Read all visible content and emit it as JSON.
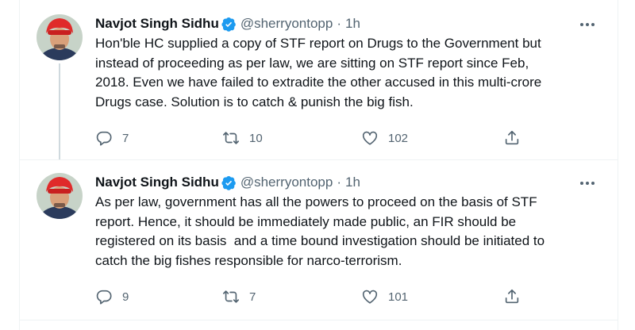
{
  "tweets": [
    {
      "author": "Navjot Singh Sidhu",
      "handle": "@sherryontopp",
      "separator": "·",
      "time": "1h",
      "text": "Hon'ble HC supplied a copy of STF report on Drugs to the Government but\ninstead of proceeding as per law, we are sitting on STF report since Feb,\n2018. Even we have failed to extradite the other accused in this multi-crore\nDrugs case. Solution is to catch & punish the big fish.",
      "replies": "7",
      "retweets": "10",
      "likes": "102"
    },
    {
      "author": "Navjot Singh Sidhu",
      "handle": "@sherryontopp",
      "separator": "·",
      "time": "1h",
      "text": "As per law, government has all the powers to proceed on the basis of STF\nreport. Hence, it should be immediately made public, an FIR should be\nregistered on its basis  and a time bound investigation should be initiated to\ncatch the big fishes responsible for narco-terrorism.",
      "replies": "9",
      "retweets": "7",
      "likes": "101"
    }
  ],
  "icons": {
    "verified": "verified-badge-icon",
    "more": "more-horizontal-icon",
    "reply": "reply-icon",
    "retweet": "retweet-icon",
    "like": "heart-icon",
    "share": "share-icon"
  },
  "colors": {
    "text": "#0f1419",
    "secondary": "#536471",
    "verified": "#1d9bf0",
    "divider": "#eff3f4",
    "thread_line": "#cfd9de"
  }
}
